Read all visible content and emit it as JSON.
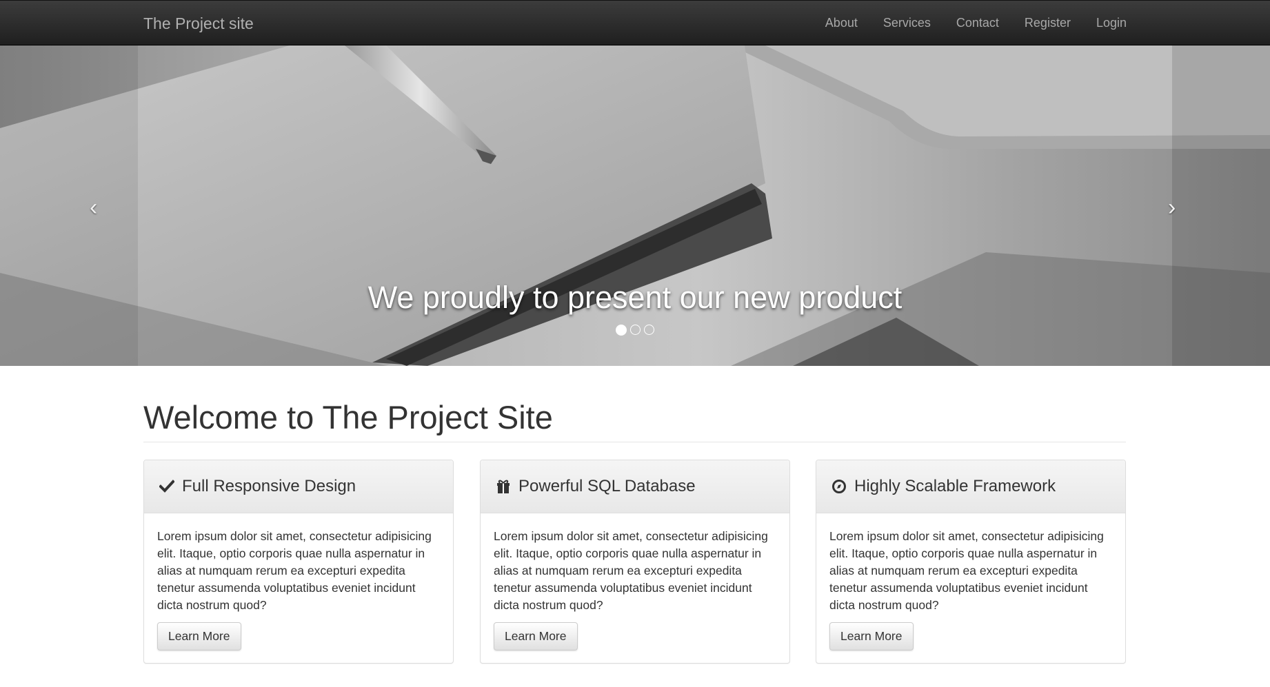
{
  "navbar": {
    "brand": "The Project site",
    "links": [
      "About",
      "Services",
      "Contact",
      "Register",
      "Login"
    ]
  },
  "carousel": {
    "caption": "We proudly to present our new product",
    "prev_glyph": "‹",
    "next_glyph": "›",
    "slide_count": 3,
    "active_slide": 1
  },
  "main": {
    "title": "Welcome to The Project Site",
    "panels": [
      {
        "icon": "check-icon",
        "title": "Full Responsive Design",
        "text": "Lorem ipsum dolor sit amet, consectetur adipisicing elit. Itaque, optio corporis quae nulla aspernatur in alias at numquam rerum ea excepturi expedita tenetur assumenda voluptatibus eveniet incidunt dicta nostrum quod?",
        "button": "Learn More"
      },
      {
        "icon": "gift-icon",
        "title": "Powerful SQL Database",
        "text": "Lorem ipsum dolor sit amet, consectetur adipisicing elit. Itaque, optio corporis quae nulla aspernatur in alias at numquam rerum ea excepturi expedita tenetur assumenda voluptatibus eveniet incidunt dicta nostrum quod?",
        "button": "Learn More"
      },
      {
        "icon": "compass-icon",
        "title": "Highly Scalable Framework",
        "text": "Lorem ipsum dolor sit amet, consectetur adipisicing elit. Itaque, optio corporis quae nulla aspernatur in alias at numquam rerum ea excepturi expedita tenetur assumenda voluptatibus eveniet incidunt dicta nostrum quod?",
        "button": "Learn More"
      }
    ]
  },
  "colors": {
    "navbar": "#262626",
    "nav_text": "#a8a8a8",
    "heading_text": "#333333",
    "panel_border": "#dddddd"
  }
}
